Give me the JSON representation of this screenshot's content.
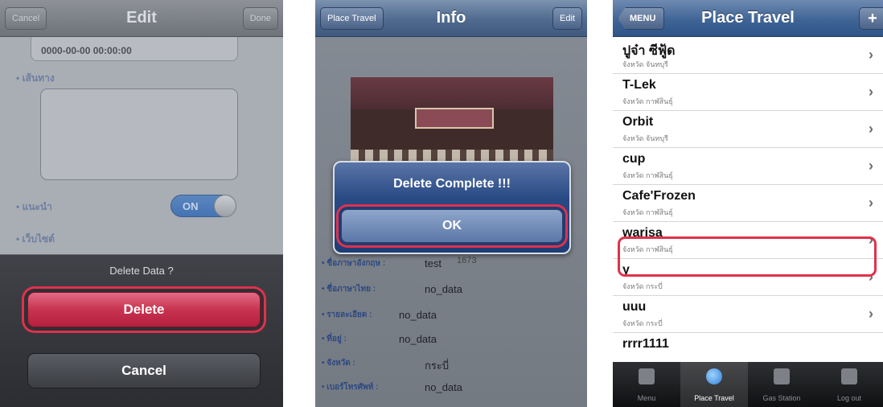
{
  "edit_screen": {
    "nav": {
      "left": "Cancel",
      "title": "Edit",
      "right": "Done"
    },
    "date_value": "0000-00-00 00:00:00",
    "route_label": "• เส้นทาง",
    "recommend_label": "• แนะนำ",
    "toggle_label": "ON",
    "website_label": "• เว็บไซต์",
    "sheet_title": "Delete Data ?",
    "delete_label": "Delete",
    "cancel_label": "Cancel"
  },
  "info_screen": {
    "nav": {
      "left": "Place Travel",
      "title": "Info",
      "right": "Edit"
    },
    "dialog_title": "Delete Complete !!!",
    "dialog_ok": "OK",
    "partial_text": "1673",
    "rows": [
      {
        "label": "• ชื่อภาษาอังกฤษ :",
        "value": "test"
      },
      {
        "label": "• ชื่อภาษาไทย :",
        "value": "no_data"
      },
      {
        "label": "• รายละเอียด :",
        "value": "no_data"
      },
      {
        "label": "• ที่อยู่ :",
        "value": "no_data"
      },
      {
        "label": "• จังหวัด :",
        "value": "กระบี่"
      },
      {
        "label": "• เบอร์โทรศัพท์ :",
        "value": "no_data"
      }
    ]
  },
  "list_screen": {
    "nav": {
      "left": "MENU",
      "title": "Place Travel",
      "right": "+"
    },
    "items": [
      {
        "name": "ปูจ๋า ซีฟู้ด",
        "sub": "จังหวัด จันทบุรี"
      },
      {
        "name": "T-Lek",
        "sub": "จังหวัด กาฬสินธุ์"
      },
      {
        "name": "Orbit",
        "sub": "จังหวัด จันทบุรี"
      },
      {
        "name": "cup",
        "sub": "จังหวัด กาฬสินธุ์"
      },
      {
        "name": "Cafe'Frozen",
        "sub": "จังหวัด กาฬสินธุ์"
      },
      {
        "name": "warisa",
        "sub": "จังหวัด กาฬสินธุ์"
      },
      {
        "name": "y",
        "sub": "จังหวัด กระบี่"
      },
      {
        "name": "uuu",
        "sub": "จังหวัด กระบี่"
      }
    ],
    "partial_item": "rrrr1111",
    "chevron": "›",
    "tabs": [
      {
        "label": "Menu",
        "icon": "home-icon"
      },
      {
        "label": "Place Travel",
        "icon": "globe-icon"
      },
      {
        "label": "Gas Station",
        "icon": "gas-pump-icon"
      },
      {
        "label": "Log out",
        "icon": "door-icon"
      }
    ]
  },
  "colors": {
    "highlight": "#e0314c",
    "nav_blue": "#3f6596",
    "delete_red": "#c7334f"
  }
}
